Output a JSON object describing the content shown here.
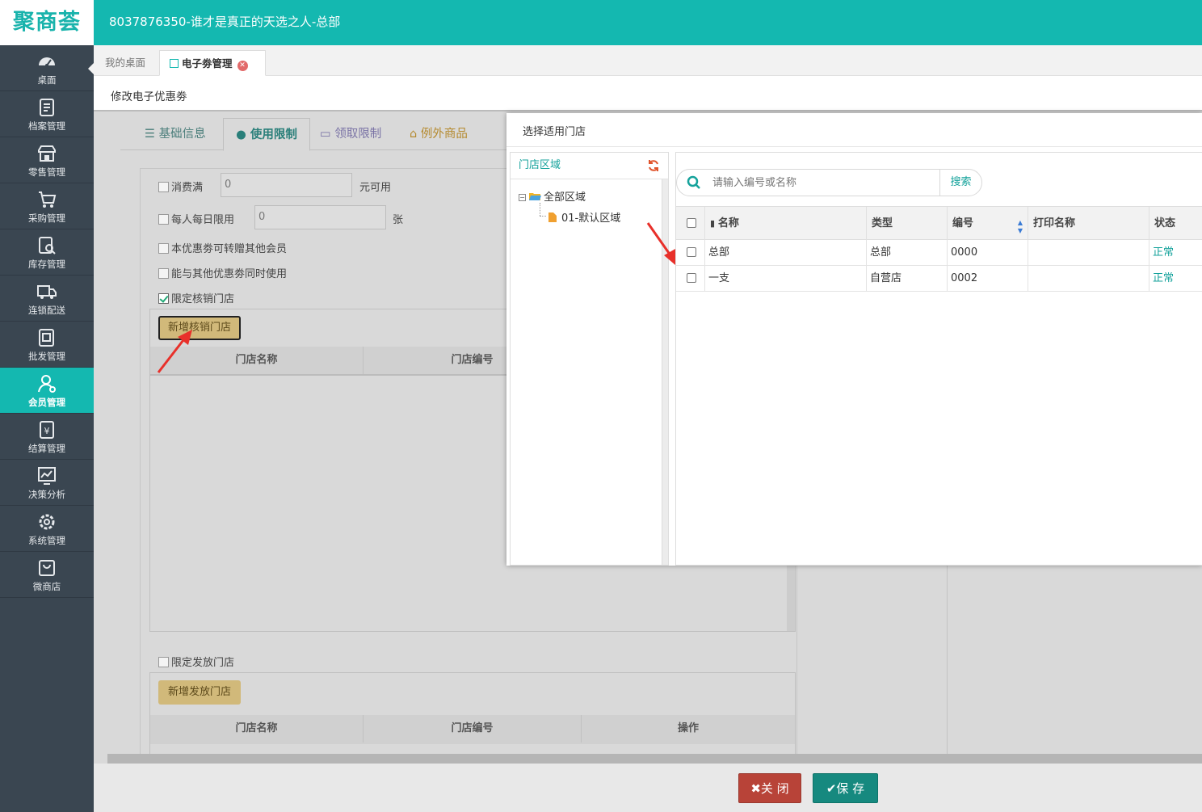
{
  "logo": "聚商荟",
  "header": {
    "title": "8037876350-谁才是真正的天选之人-总部"
  },
  "colors": {
    "brand": "#14b8b0",
    "sidebar": "#3a4651",
    "close": "#b84338",
    "save": "#16897f",
    "gold": "#d1b97a"
  },
  "sidebar": {
    "items": [
      {
        "label": "桌面",
        "icon": "dashboard-icon"
      },
      {
        "label": "档案管理",
        "icon": "archive-icon"
      },
      {
        "label": "零售管理",
        "icon": "store-icon"
      },
      {
        "label": "采购管理",
        "icon": "cart-icon"
      },
      {
        "label": "库存管理",
        "icon": "inventory-icon"
      },
      {
        "label": "连锁配送",
        "icon": "truck-icon"
      },
      {
        "label": "批发管理",
        "icon": "wholesale-icon"
      },
      {
        "label": "会员管理",
        "icon": "member-icon",
        "active": true
      },
      {
        "label": "结算管理",
        "icon": "settlement-icon"
      },
      {
        "label": "决策分析",
        "icon": "chart-icon"
      },
      {
        "label": "系统管理",
        "icon": "gear-icon"
      },
      {
        "label": "微商店",
        "icon": "bag-icon"
      }
    ]
  },
  "tabs": {
    "desk": "我的桌面",
    "current": "电子劵管理"
  },
  "page": {
    "title": "修改电子优惠劵"
  },
  "content_tabs": [
    "基础信息",
    "使用限制",
    "领取限制",
    "例外商品"
  ],
  "form": {
    "spend_label": "消费满",
    "spend_value": "0",
    "spend_suffix": "元可用",
    "daily_label": "每人每日限用",
    "daily_value": "0",
    "daily_suffix": "张",
    "transfer_label": "本优惠劵可转赠其他会员",
    "combine_label": "能与其他优惠劵同时使用",
    "limit_redeem_label": "限定核销门店",
    "add_redeem_btn": "新增核销门店",
    "limit_issue_label": "限定发放门店",
    "add_issue_btn": "新增发放门店"
  },
  "store_table": {
    "col_name": "门店名称",
    "col_code": "门店编号",
    "col_op": "操作"
  },
  "modal": {
    "title": "选择适用门店",
    "tree_title": "门店区域",
    "tree": {
      "root": "全部区域",
      "child": "01-默认区域"
    },
    "search_placeholder": "请输入编号或名称",
    "search_btn": "搜索",
    "columns": [
      "名称",
      "类型",
      "编号",
      "打印名称",
      "状态"
    ],
    "rows": [
      {
        "name": "总部",
        "type": "总部",
        "code": "0000",
        "print": "",
        "status": "正常"
      },
      {
        "name": "一支",
        "type": "自营店",
        "code": "0002",
        "print": "",
        "status": "正常"
      }
    ]
  },
  "footer": {
    "close": "关 闭",
    "save": "保 存"
  }
}
